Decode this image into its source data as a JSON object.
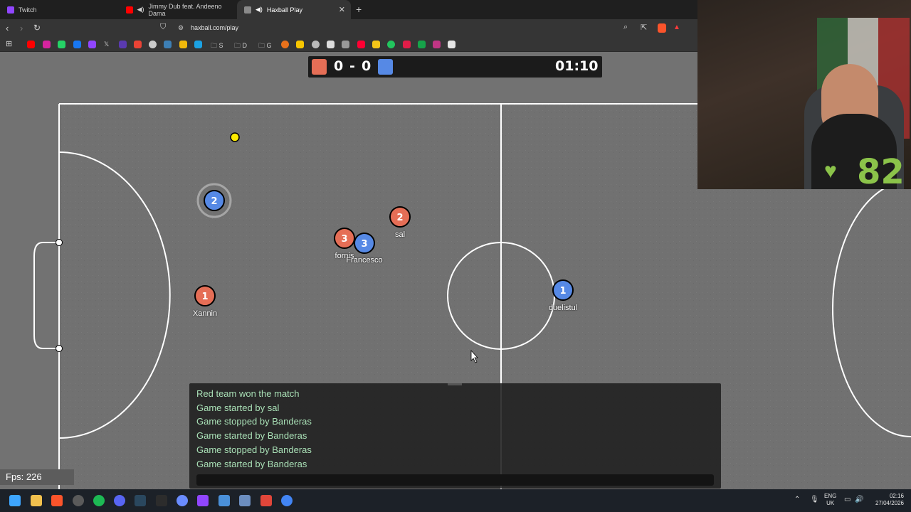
{
  "browser": {
    "tabs": [
      {
        "label": "Twitch",
        "color": "#9146ff"
      },
      {
        "label": "Jimmy Dub feat. Andeeno Dama",
        "color": "#ff0000"
      },
      {
        "label": "Haxball Play",
        "color": "#8a8a8a"
      }
    ],
    "url": "haxball.com/play",
    "bookmark_folders": [
      "S",
      "D",
      "G"
    ]
  },
  "scoreboard": {
    "red_score": "0",
    "separator": "-",
    "blue_score": "0",
    "time": "01:10",
    "red_color": "#e56e56",
    "blue_color": "#5689e5"
  },
  "players": [
    {
      "team": "blue",
      "number": "2",
      "name": "",
      "controlled": true
    },
    {
      "team": "red",
      "number": "2",
      "name": "sal"
    },
    {
      "team": "red",
      "number": "3",
      "name": "fornis"
    },
    {
      "team": "blue",
      "number": "3",
      "name": "Francesco"
    },
    {
      "team": "red",
      "number": "1",
      "name": "Xannin"
    },
    {
      "team": "blue",
      "number": "1",
      "name": "duelistul"
    }
  ],
  "chat": {
    "messages": [
      "Red team won the match",
      "Game started by sal",
      "Game stopped by Banderas",
      "Game started by Banderas",
      "Game stopped by Banderas",
      "Game started by Banderas"
    ]
  },
  "fps": "Fps: 226",
  "webcam": {
    "heart_rate": "82",
    "heart_icon": "heart-icon"
  },
  "tray": {
    "lang_top": "ENG",
    "lang_bottom": "UK",
    "time": "02:16",
    "date": "27/04/2026"
  }
}
